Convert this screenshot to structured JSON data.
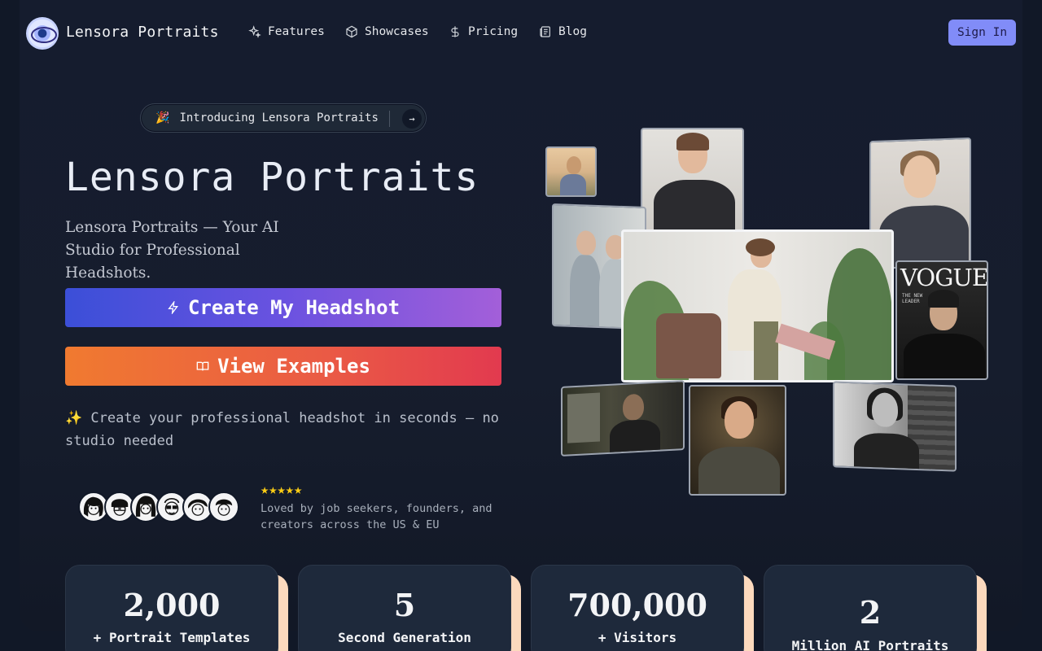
{
  "brand": {
    "name": "Lensora Portraits",
    "logo_icon": "eye-icon"
  },
  "nav": {
    "items": [
      {
        "label": "Features",
        "icon": "sparkles-icon"
      },
      {
        "label": "Showcases",
        "icon": "cube-icon"
      },
      {
        "label": "Pricing",
        "icon": "dollar-icon"
      },
      {
        "label": "Blog",
        "icon": "newspaper-icon"
      }
    ],
    "signin_label": "Sign In"
  },
  "hero": {
    "pill_emoji": "🎉",
    "pill_text": "Introducing Lensora Portraits",
    "pill_arrow": "→",
    "title": "Lensora Portraits",
    "subtitle": "Lensora Portraits — Your AI Studio for Professional Headshots.",
    "cta_primary": "Create My Headshot",
    "cta_secondary": "View Examples",
    "tagline": "✨ Create your professional headshot in seconds — no studio needed",
    "stars": "★★★★★",
    "loved_text": "Loved by job seekers, founders, and creators across the US & EU"
  },
  "stats": [
    {
      "value": "2,000",
      "label": "+ Portrait Templates"
    },
    {
      "value": "5",
      "label": "Second Generation"
    },
    {
      "value": "700,000",
      "label": "+ Visitors"
    },
    {
      "value": "2",
      "label": "Million AI Portraits"
    }
  ],
  "magazine": {
    "masthead": "VOGUE",
    "cover_lines": "THE NEW LEADER"
  },
  "colors": {
    "accent": "#818cf8",
    "star": "#facc15",
    "card_shadow": "#fcd9bd"
  }
}
